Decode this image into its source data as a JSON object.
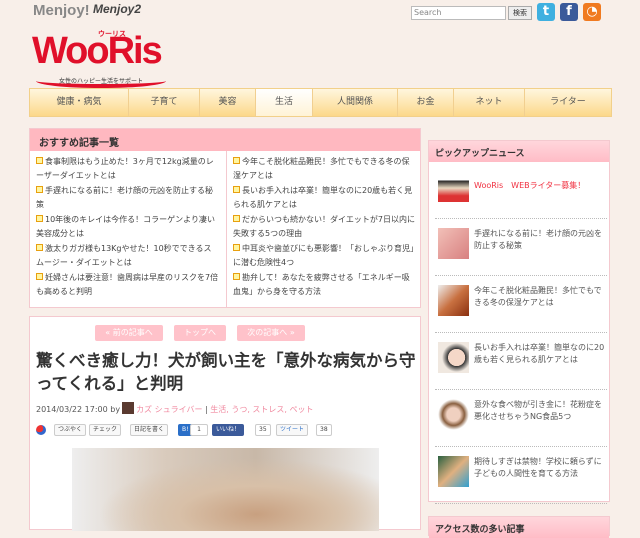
{
  "header": {
    "brand_small_1": "Menjoy!",
    "brand_small_2": "Menjoy2",
    "logo": "WooRis",
    "logo_ruby": "ウーリス",
    "logo_tagline": "女性のハッピー生活をサポート",
    "search_placeholder": "Search",
    "search_button": "検索",
    "social": [
      "twitter-icon",
      "facebook-icon",
      "rss-icon"
    ]
  },
  "nav": [
    "健康・病気",
    "子育て",
    "美容",
    "生活",
    "人間関係",
    "お金",
    "ネット",
    "ライター"
  ],
  "recommended": {
    "title": "おすすめ記事一覧",
    "left": [
      "食事制限はもう止めた！3ヶ月で12kg減量のレーザーダイエットとは",
      "手遅れになる前に！老け顔の元凶を防止する秘策",
      "10年後のキレイは今作る！コラーゲンより凄い美容成分とは",
      "激太りガガ様も13Kgやせた！10秒でできるスムージー・ダイエットとは",
      "妊婦さんは要注意！歯周病は早産のリスクを7倍も高めると判明"
    ],
    "right": [
      "今年こそ脱化粧品難民！多忙でもできる冬の保湿ケアとは",
      "長いお手入れは卒業！簡単なのに20歳も若く見られる肌ケアとは",
      "だからいつも続かない！ダイエットが7日以内に失敗する5つの理由",
      "中耳炎や歯並びにも悪影響！「おしゃぶり育児」に潜む危険性4つ",
      "勘弁して！あなたを疲弊させる「エネルギー吸血鬼」から身を守る方法"
    ]
  },
  "article": {
    "prev": "« 前の記事へ",
    "top": "トップへ",
    "next": "次の記事へ »",
    "title": "驚くべき癒し力！犬が飼い主を「意外な病気から守ってくれる」と判明",
    "date": "2014/03/22 17:00 by",
    "author": "カズ シュライバー",
    "sep": "|",
    "tags": "生活, うつ, ストレス, ペット",
    "share": {
      "tsubuyaku": "つぶやく",
      "check": "チェック",
      "diary": "日記を書く",
      "hatena": "B!",
      "hatena_count": "1",
      "like": "いいね！",
      "like_count": "35",
      "tweet": "ツイート",
      "tweet_count": "38"
    }
  },
  "sidebar": {
    "pickup_title": "ピックアップニュース",
    "pickup": [
      "WooRis　WEBライター募集！",
      "手遅れになる前に！老け顔の元凶を防止する秘策",
      "今年こそ脱化粧品難民！多忙でもできる冬の保湿ケアとは",
      "長いお手入れは卒業！簡単なのに20歳も若く見られる肌ケアとは",
      "意外な食べ物が引き金に！花粉症を悪化させちゃうNG食品5つ",
      "期待しすぎは禁物！学校に頼らずに子どもの人間性を育てる方法"
    ],
    "access_title": "アクセス数の多い記事"
  },
  "colors": {
    "accent": "#e0102a",
    "pink": "#ffb8c0"
  }
}
